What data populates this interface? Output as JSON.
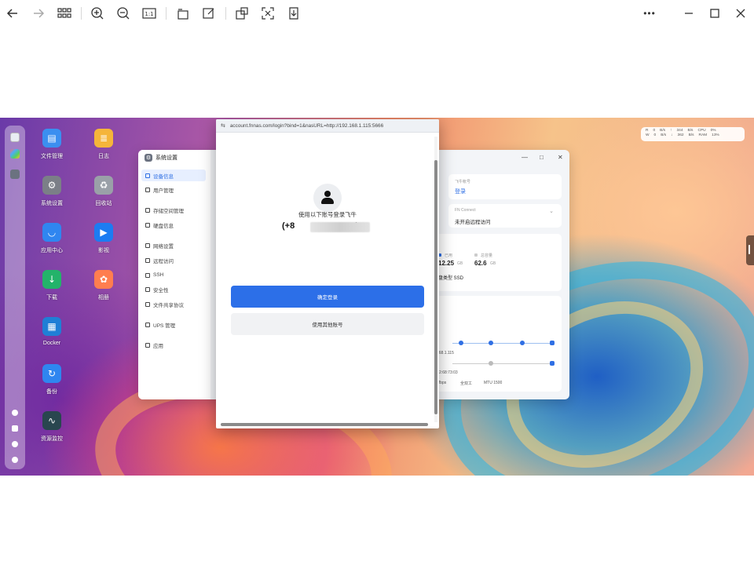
{
  "toolbar": {
    "icons": [
      "back-icon",
      "forward-icon",
      "grid-icon",
      "zoom-in-icon",
      "zoom-out-icon",
      "actual-size-icon",
      "rotate-icon",
      "edit-icon",
      "crop-icon",
      "fit-icon",
      "download-icon",
      "more-icon",
      "minimize-icon",
      "maximize-icon",
      "close-icon"
    ],
    "actual_size": "1:1",
    "more": "•••"
  },
  "desktop": {
    "icons": [
      {
        "label": "文件管理",
        "color": "#3b8ff0",
        "glyph": "▤"
      },
      {
        "label": "日志",
        "color": "#f5b53a",
        "glyph": "≣"
      },
      {
        "label": "系统设置",
        "color": "#7b7f87",
        "glyph": "⚙"
      },
      {
        "label": "回收站",
        "color": "#9aa0a8",
        "glyph": "♻"
      },
      {
        "label": "应用中心",
        "color": "#2f86f0",
        "glyph": "◡"
      },
      {
        "label": "影视",
        "color": "#1c7cf2",
        "glyph": "▶"
      },
      {
        "label": "下载",
        "color": "#23b36a",
        "glyph": "↓"
      },
      {
        "label": "相册",
        "color": "#ff7e4f",
        "glyph": "✿"
      },
      {
        "label": "Docker",
        "color": "#1f7fd6",
        "glyph": "▦"
      },
      {
        "label": "备份",
        "color": "#2f86f0",
        "glyph": "↻"
      },
      {
        "label": "资源监控",
        "color": "#29464f",
        "glyph": "∿"
      }
    ]
  },
  "status_widget": {
    "rows": [
      [
        "R",
        "0",
        "B/s",
        "↑",
        "344",
        "B/s",
        "CPU",
        "0%"
      ],
      [
        "W",
        "0",
        "B/s",
        "↓",
        "362",
        "B/s",
        "RAM",
        "13%"
      ]
    ]
  },
  "settings_window": {
    "title": "系统设置",
    "nav": [
      {
        "label": "设备信息",
        "active": true
      },
      {
        "label": "用户管理",
        "active": false
      },
      {
        "label": "存储空间管理",
        "active": false
      },
      {
        "label": "硬盘信息",
        "active": false
      },
      {
        "label": "网络设置",
        "active": false
      },
      {
        "label": "远程访问",
        "active": false
      },
      {
        "label": "SSH",
        "active": false
      },
      {
        "label": "安全性",
        "active": false
      },
      {
        "label": "文件共享协议",
        "active": false
      },
      {
        "label": "UPS 管理",
        "active": false
      },
      {
        "label": "应用",
        "active": false
      }
    ],
    "account_label": "飞牛帐号",
    "account_value": "登录",
    "connect_label": "FN Connect",
    "connect_value": "未开启远程访问",
    "used_label": "已用",
    "used_value": "12.25",
    "used_unit": "GB",
    "total_label": "总容量",
    "total_value": "62.6",
    "total_unit": "GB",
    "disk_type": "硬盘类型 SSD",
    "net_ip": "168.1.115",
    "net_mac": "F2:68:73:03",
    "net_speed": "Mbps",
    "net_duplex": "全双工",
    "net_mtu": "MTU 1500",
    "net_zero": "0"
  },
  "browser_popup": {
    "url": "account.fnnas.com/login?bind=1&nasURL=http://192.168.1.115:5666",
    "login_prompt": "使用以下账号登录飞牛",
    "account_prefix": "(+8",
    "account_suffix": "/",
    "confirm_button": "确定登录",
    "other_button": "使用其他账号"
  }
}
